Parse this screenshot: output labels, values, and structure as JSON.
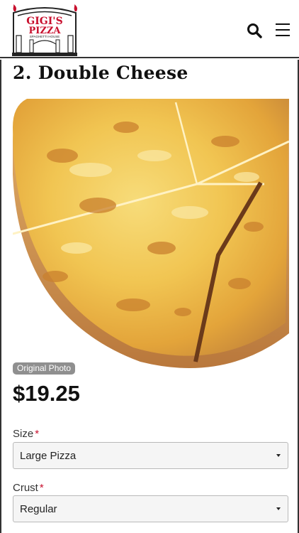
{
  "header": {
    "logo": {
      "line1": "GIGI'S",
      "line2": "PIZZA",
      "line3": "SPAGHETTI HOUSE"
    },
    "icons": {
      "search": "search-icon",
      "menu": "hamburger-menu-icon"
    }
  },
  "item": {
    "title": "2. Double Cheese",
    "photo_badge": "Original Photo",
    "price": "$19.25"
  },
  "options": {
    "size": {
      "label": "Size",
      "required_mark": "*",
      "value": "Large Pizza"
    },
    "crust": {
      "label": "Crust",
      "required_mark": "*",
      "value": "Regular"
    }
  },
  "colors": {
    "brand_red": "#c8102e",
    "badge_gray": "#8f8f8f",
    "select_bg": "#f5f5f5"
  }
}
